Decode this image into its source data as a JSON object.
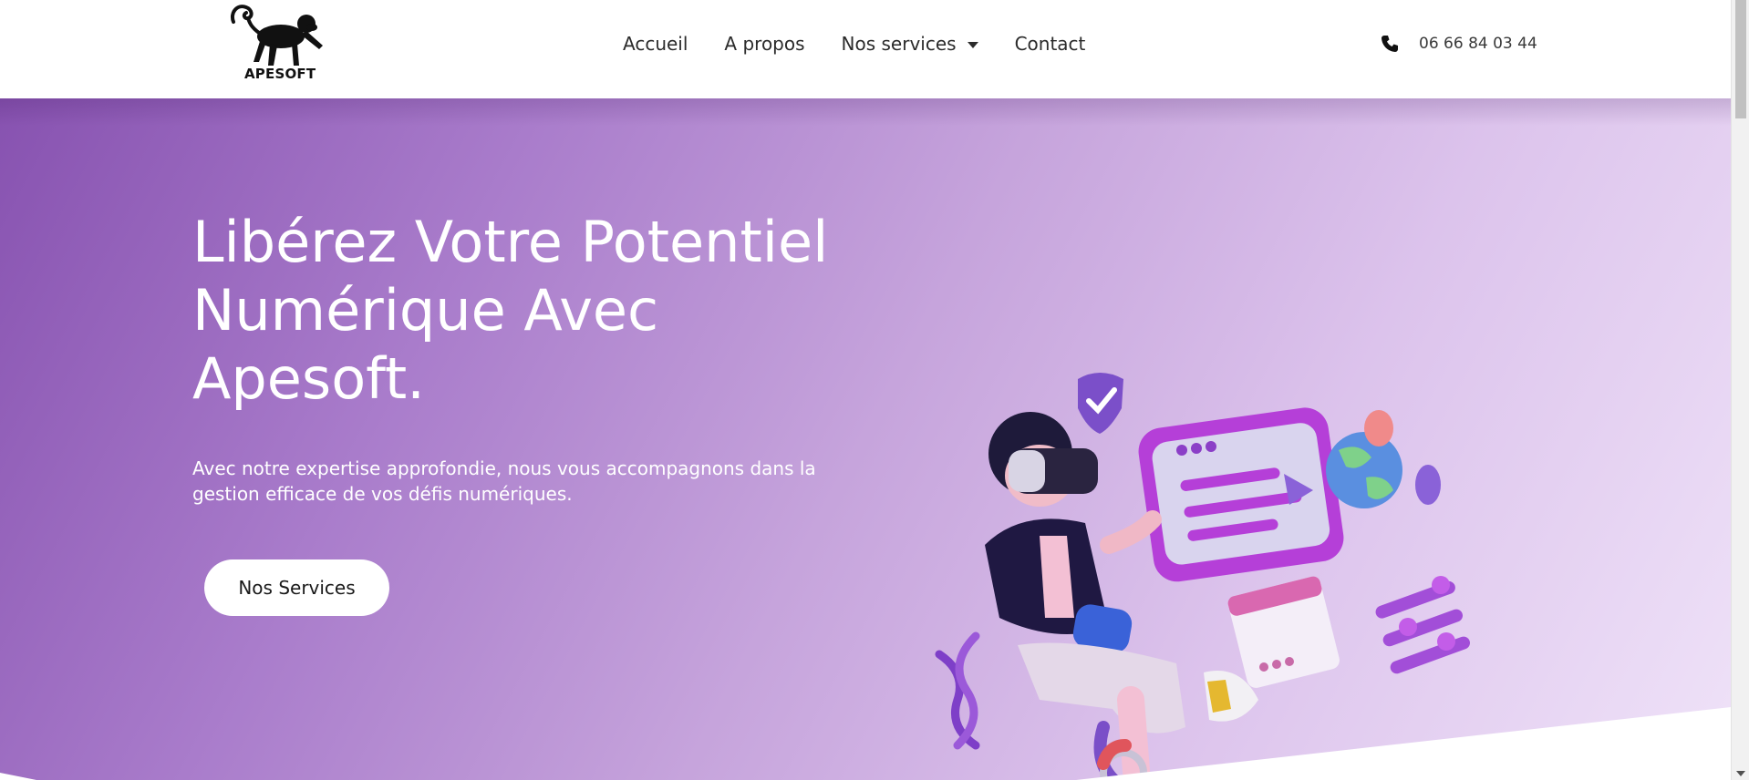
{
  "brand": {
    "name": "APESOFT"
  },
  "nav": {
    "items": [
      {
        "label": "Accueil"
      },
      {
        "label": "A propos"
      },
      {
        "label": "Nos services"
      },
      {
        "label": "Contact"
      }
    ]
  },
  "contact": {
    "phone": "06 66 84 03 44"
  },
  "hero": {
    "title": "Libérez Votre Potentiel Numérique Avec Apesoft.",
    "subtitle": "Avec notre expertise approfondie, nous vous accompagnons dans la gestion efficace de vos défis numériques.",
    "button": "Nos Services"
  },
  "icons": {
    "logo": "monkey-logo-icon",
    "dropdown": "caret-down-icon",
    "phone": "phone-icon"
  },
  "colors": {
    "hero_start": "#8752b0",
    "hero_end": "#efe2f8",
    "text_dark": "#2b2b2b",
    "button_bg": "#ffffff"
  }
}
